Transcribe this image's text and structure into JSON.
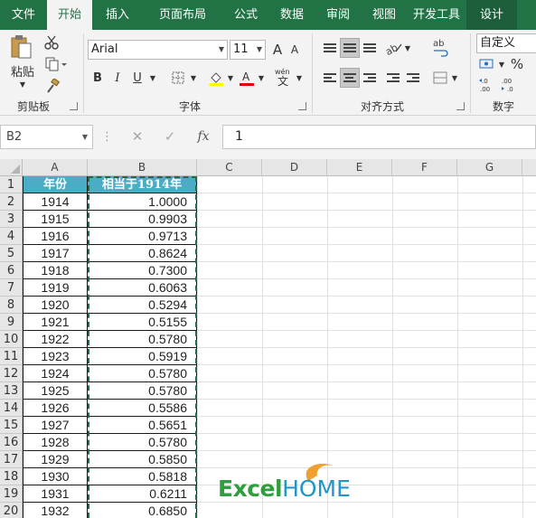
{
  "ribbon_tabs": [
    "文件",
    "开始",
    "插入",
    "页面布局",
    "公式",
    "数据",
    "审阅",
    "视图",
    "开发工具",
    "设计"
  ],
  "active_tab": "开始",
  "groups": {
    "clipboard": {
      "label": "剪贴板",
      "paste_label": "粘贴"
    },
    "font": {
      "label": "字体",
      "font_name": "Arial",
      "font_size": "11",
      "bold": "B",
      "italic": "I",
      "underline": "U",
      "grow": "A",
      "shrink": "A",
      "phonetic": "wén"
    },
    "alignment": {
      "label": "对齐方式"
    },
    "number": {
      "label": "数字",
      "format": "自定义",
      "percent": "%"
    }
  },
  "formula_bar": {
    "name_box": "B2",
    "fx_label": "fx",
    "cancel_symbol": "✕",
    "enter_symbol": "✓",
    "content": "1"
  },
  "columns": [
    "A",
    "B",
    "C",
    "D",
    "E",
    "F",
    "G"
  ],
  "rows": [
    "1",
    "2",
    "3",
    "4",
    "5",
    "6",
    "7",
    "8",
    "9",
    "10",
    "11",
    "12",
    "13",
    "14",
    "15",
    "16",
    "17",
    "18",
    "19",
    "20"
  ],
  "table": {
    "headers": [
      "年份",
      "相当于1914年"
    ],
    "rows": [
      [
        "1914",
        "1.0000"
      ],
      [
        "1915",
        "0.9903"
      ],
      [
        "1916",
        "0.9713"
      ],
      [
        "1917",
        "0.8624"
      ],
      [
        "1918",
        "0.7300"
      ],
      [
        "1919",
        "0.6063"
      ],
      [
        "1920",
        "0.5294"
      ],
      [
        "1921",
        "0.5155"
      ],
      [
        "1922",
        "0.5780"
      ],
      [
        "1923",
        "0.5919"
      ],
      [
        "1924",
        "0.5780"
      ],
      [
        "1925",
        "0.5780"
      ],
      [
        "1926",
        "0.5586"
      ],
      [
        "1927",
        "0.5651"
      ],
      [
        "1928",
        "0.5780"
      ],
      [
        "1929",
        "0.5850"
      ],
      [
        "1930",
        "0.5818"
      ],
      [
        "1931",
        "0.6211"
      ],
      [
        "1932",
        "0.6850"
      ]
    ]
  },
  "watermark": {
    "brand_a": "Excel",
    "brand_b": "HOME"
  },
  "colors": {
    "ribbon": "#217346",
    "header_fill": "#4bacc6",
    "marquee": "#1f6b45"
  }
}
